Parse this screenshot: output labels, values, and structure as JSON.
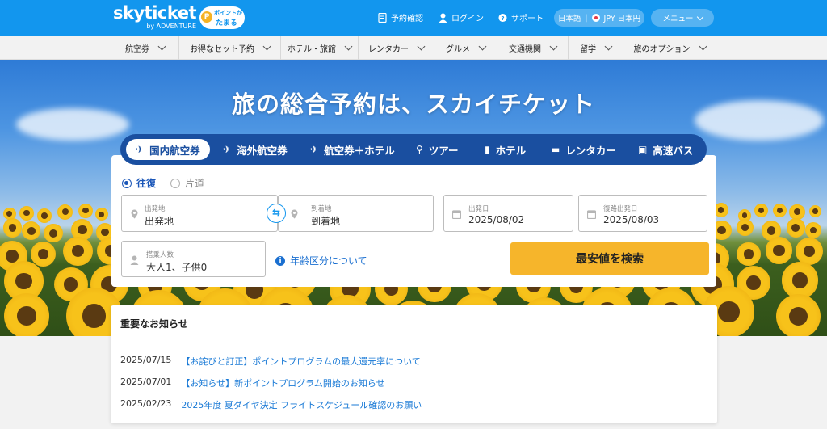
{
  "brand": {
    "logo": "skyticket",
    "logo_sub": "by ADVENTURE",
    "point_badge_top": "ポイントが",
    "point_badge_bottom": "たまる",
    "point_badge_coin": "P"
  },
  "header": {
    "links": [
      {
        "label": "予約確認",
        "icon": "document-icon"
      },
      {
        "label": "ログイン",
        "icon": "user-icon"
      },
      {
        "label": "サポート",
        "icon": "help-circle-icon"
      }
    ],
    "language": {
      "lang": "日本語",
      "currency": "JPY 日本円"
    },
    "menu_label": "メニュー"
  },
  "nav": {
    "items": [
      "航空券",
      "お得なセット予約",
      "ホテル・旅館",
      "レンタカー",
      "グルメ",
      "交通機関",
      "留学",
      "旅のオプション"
    ]
  },
  "hero": {
    "title": "旅の総合予約は、スカイチケット"
  },
  "tabs": [
    {
      "label": "国内航空券",
      "icon": "plane-icon",
      "active": true
    },
    {
      "label": "海外航空券",
      "icon": "globe-plane-icon",
      "active": false
    },
    {
      "label": "航空券＋ホテル",
      "icon": "plane-hotel-icon",
      "active": false
    },
    {
      "label": "ツアー",
      "icon": "walker-icon",
      "active": false
    },
    {
      "label": "ホテル",
      "icon": "building-icon",
      "active": false
    },
    {
      "label": "レンタカー",
      "icon": "car-icon",
      "active": false
    },
    {
      "label": "高速バス",
      "icon": "bus-icon",
      "active": false
    }
  ],
  "search": {
    "trip_types": [
      {
        "label": "往復",
        "selected": true
      },
      {
        "label": "片道",
        "selected": false
      }
    ],
    "departure": {
      "label": "出発地",
      "value": "出発地"
    },
    "arrival": {
      "label": "到着地",
      "value": "到着地"
    },
    "depart_date": {
      "label": "出発日",
      "value": "2025/08/02"
    },
    "return_date": {
      "label": "復路出発日",
      "value": "2025/08/03"
    },
    "passengers": {
      "label": "搭乗人数",
      "value": "大人1、子供0"
    },
    "age_link": "年齢区分について",
    "search_button": "最安値を検索"
  },
  "notices": {
    "title": "重要なお知らせ",
    "items": [
      {
        "date": "2025/07/15",
        "text": "【お詫びと訂正】ポイントプログラムの最大還元率について"
      },
      {
        "date": "2025/07/01",
        "text": "【お知らせ】新ポイントプログラム開始のお知らせ"
      },
      {
        "date": "2025/02/23",
        "text": "2025年度 夏ダイヤ決定 フライトスケジュール確認のお願い"
      }
    ]
  },
  "colors": {
    "header_bg": "#1296ee",
    "tab_bar_bg": "#1a4fa0",
    "search_button_bg": "#f6b52b",
    "link": "#1a7ad6"
  }
}
